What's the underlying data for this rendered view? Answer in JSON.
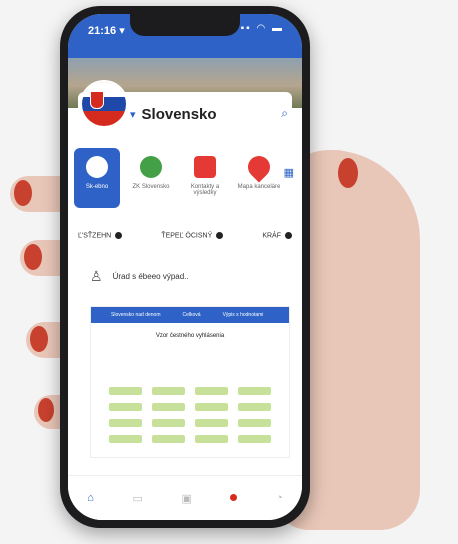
{
  "status_bar": {
    "time": "21:16 ▾",
    "icons": "▪▪ ◠ ▬"
  },
  "header": {
    "title": "Slovensko",
    "flag_colors": [
      "#ffffff",
      "#1e49a8",
      "#d52b1e"
    ],
    "search_icon": "search-icon"
  },
  "tiles": [
    {
      "label": "Sk-ebno",
      "icon": "brand-icon",
      "color": "#e94e3c"
    },
    {
      "label": "ZK Slovensko",
      "icon": "crest-icon",
      "color": "#43a047"
    },
    {
      "label": "Kontakty a výsledky",
      "icon": "message-icon",
      "color": "#e53935"
    },
    {
      "label": "Mapa kanceláre",
      "icon": "map-pin-icon",
      "color": "#e53935"
    }
  ],
  "chips": [
    "Ľ'SŤZEHN",
    "ŤEPEĽ ÓCISNÝ",
    "KRÁF"
  ],
  "recent": {
    "label": "Úrad s ébeeo výpad.."
  },
  "doc": {
    "bar_items": [
      "Slovensko nad denom",
      "Celková",
      "Výpis s hodnotami"
    ],
    "title": "Vzor čestného vyhlásenia"
  },
  "nav": {
    "items": [
      "home-icon",
      "doc-icon",
      "wallet-icon",
      "bell-icon",
      "profile-icon"
    ]
  },
  "colors": {
    "accent": "#2e62c6"
  }
}
